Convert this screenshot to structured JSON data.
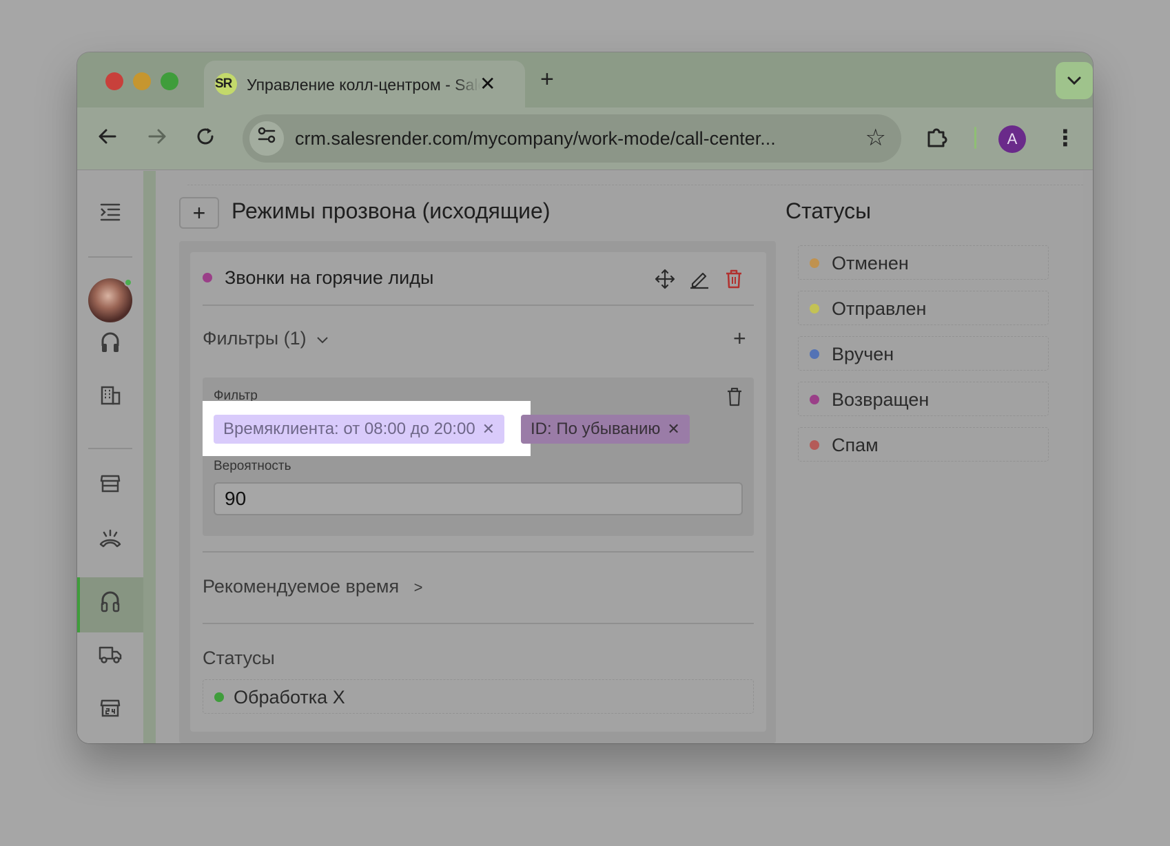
{
  "browser": {
    "tab_title": "Управление колл-центром - SalesRender",
    "tab_close": "✕",
    "new_tab": "+",
    "favicon_text": "SR",
    "url": "crm.salesrender.com/mycompany/work-mode/call-center...",
    "profile_initial": "A"
  },
  "page": {
    "add_button": "+",
    "modes_title": "Режимы прозвона (исходящие)",
    "statuses_title": "Статусы"
  },
  "mode": {
    "name": "Звонки на горячие лиды",
    "dot_color": "#9a3f88",
    "filters_label": "Фильтры (1)",
    "add_filter": "+",
    "filter_label": "Фильтр",
    "chips": [
      {
        "label": "Времяклиента: от 08:00 до 20:00",
        "remove": "✕"
      },
      {
        "label": "ID: По убыванию",
        "remove": "✕"
      }
    ],
    "probability_label": "Вероятность",
    "probability_value": "90",
    "recommended_time": "Рекомендуемое время",
    "statuses_label": "Статусы",
    "selected_status": {
      "label": "Обработка",
      "remove": "X",
      "color": "#3f9d3b"
    }
  },
  "statuses": [
    {
      "label": "Отменен",
      "color": "#c0924f"
    },
    {
      "label": "Отправлен",
      "color": "#c3c255"
    },
    {
      "label": "Вручен",
      "color": "#5473b5"
    },
    {
      "label": "Возвращен",
      "color": "#9a3f88"
    },
    {
      "label": "Спам",
      "color": "#b45b58"
    }
  ],
  "icons": {
    "sidebar": [
      "menu-indent-icon",
      "headset-icon",
      "building-icon",
      "store-icon",
      "phone-hangup-icon",
      "headset-active-icon",
      "truck-icon",
      "store-24-icon"
    ]
  }
}
